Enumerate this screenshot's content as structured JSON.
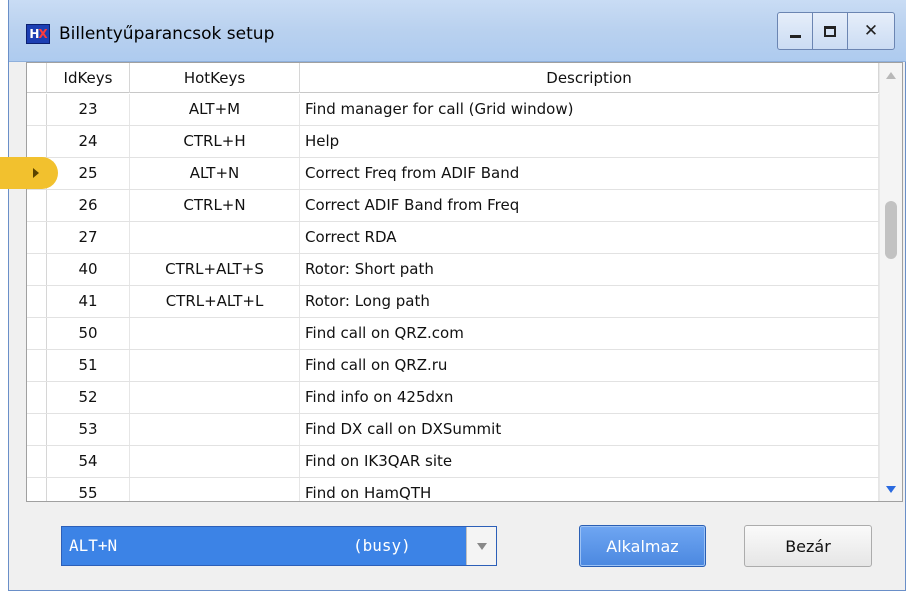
{
  "window": {
    "title": "Billentyűparancsok setup",
    "app_icon_text_a": "H",
    "app_icon_text_b": "X"
  },
  "grid": {
    "columns": [
      "IdKeys",
      "HotKeys",
      "Description"
    ],
    "selected_row_index": 2,
    "rows": [
      {
        "id": "23",
        "hotkey": "ALT+M",
        "desc": "Find manager for call (Grid window)"
      },
      {
        "id": "24",
        "hotkey": "CTRL+H",
        "desc": "Help"
      },
      {
        "id": "25",
        "hotkey": "ALT+N",
        "desc": "Correct Freq from ADIF Band"
      },
      {
        "id": "26",
        "hotkey": "CTRL+N",
        "desc": "Correct ADIF Band from Freq"
      },
      {
        "id": "27",
        "hotkey": "",
        "desc": "Correct RDA"
      },
      {
        "id": "40",
        "hotkey": "CTRL+ALT+S",
        "desc": "Rotor: Short path"
      },
      {
        "id": "41",
        "hotkey": "CTRL+ALT+L",
        "desc": "Rotor: Long path"
      },
      {
        "id": "50",
        "hotkey": "",
        "desc": "Find call on QRZ.com"
      },
      {
        "id": "51",
        "hotkey": "",
        "desc": "Find call on QRZ.ru"
      },
      {
        "id": "52",
        "hotkey": "",
        "desc": "Find info on 425dxn"
      },
      {
        "id": "53",
        "hotkey": "",
        "desc": "Find DX call on DXSummit"
      },
      {
        "id": "54",
        "hotkey": "",
        "desc": "Find on IK3QAR site"
      },
      {
        "id": "55",
        "hotkey": "",
        "desc": "Find on HamQTH"
      }
    ]
  },
  "hotkey_combo": {
    "value": "ALT+N",
    "status": "(busy)"
  },
  "buttons": {
    "apply": "Alkalmaz",
    "close": "Bezár"
  },
  "colors": {
    "titlebar": "#b9d1ef",
    "selection_marker": "#f2c12e",
    "combo_selected": "#3c83e6",
    "apply_button": "#4b88e0"
  }
}
